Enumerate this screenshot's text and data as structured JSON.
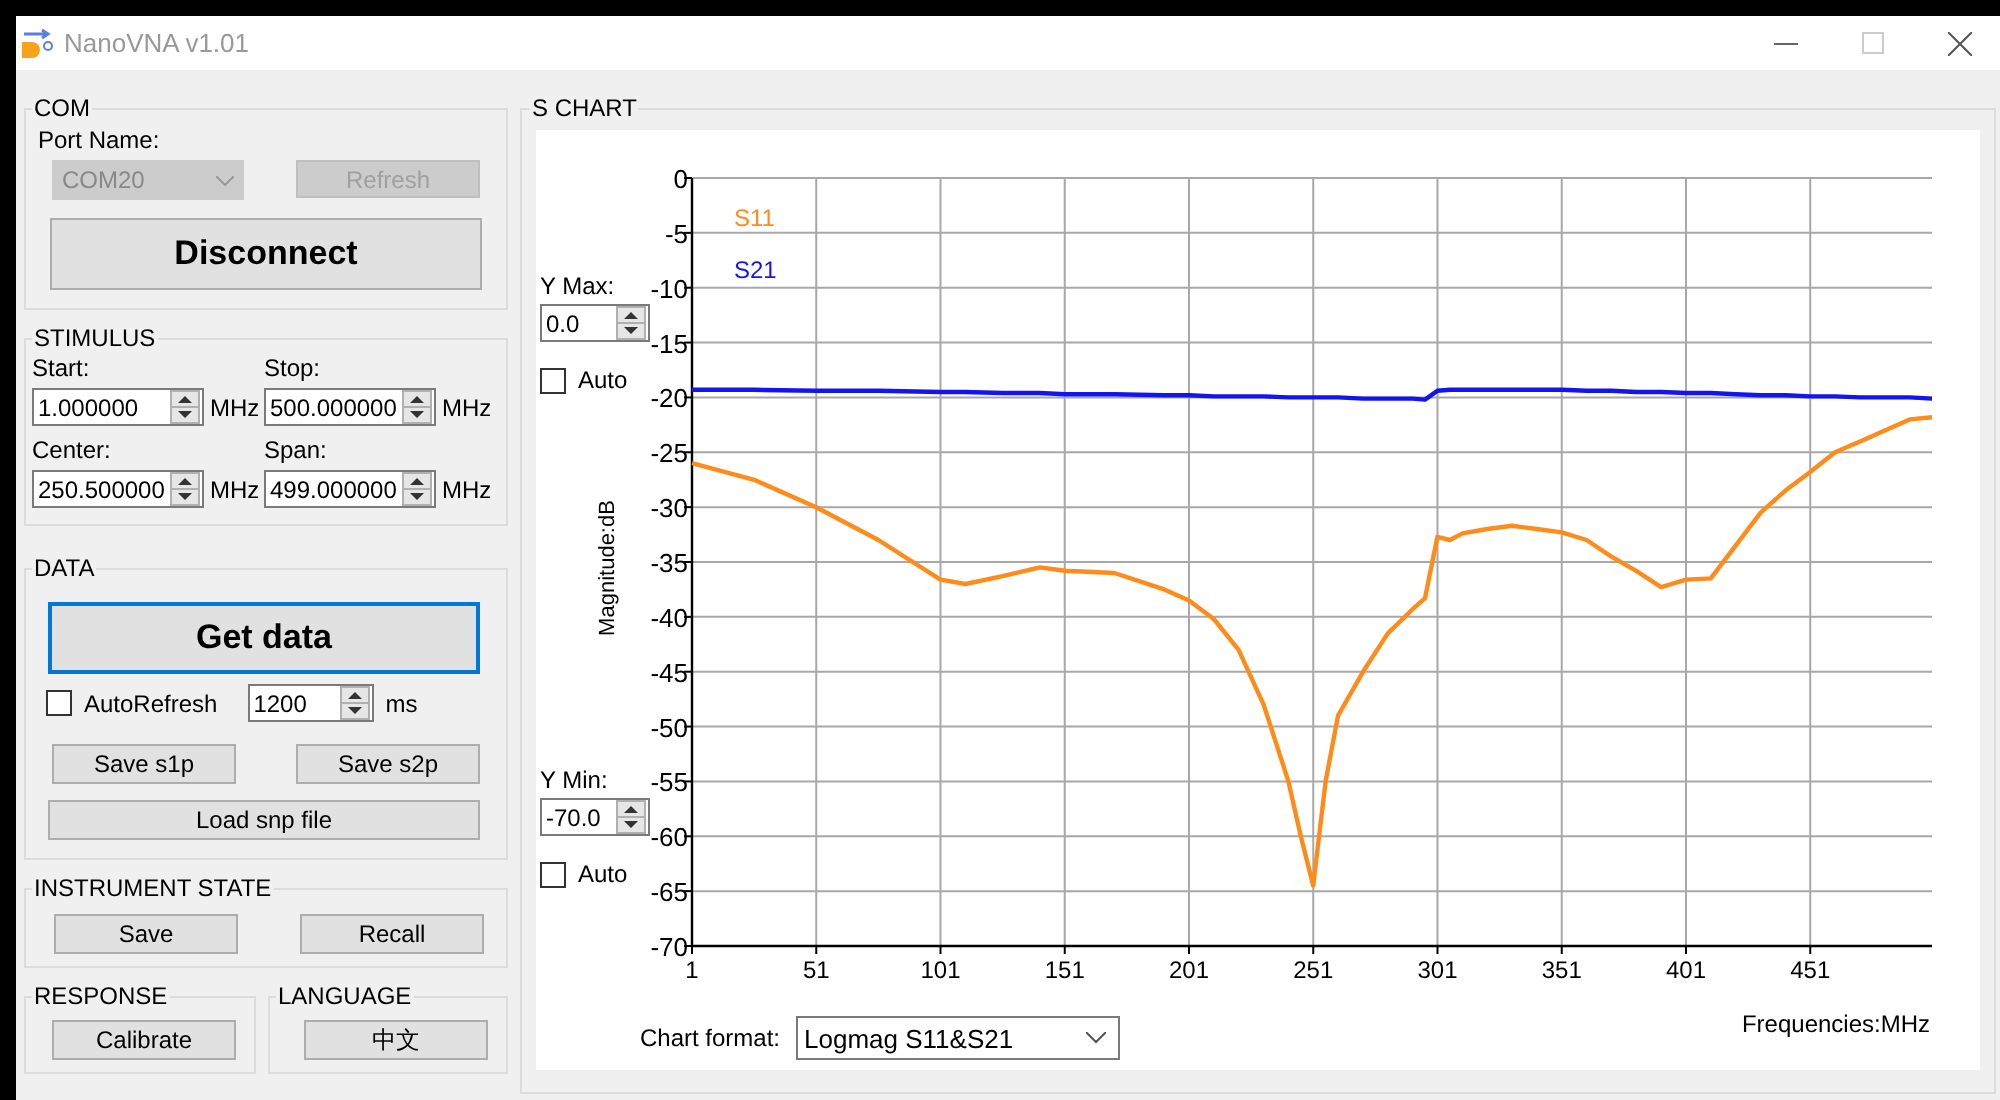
{
  "window": {
    "title": "NanoVNA v1.01"
  },
  "com": {
    "title": "COM",
    "port_label": "Port Name:",
    "port": {
      "value": "COM20",
      "disabled": true
    },
    "refresh": {
      "label": "Refresh",
      "disabled": true
    },
    "connect_button": {
      "label": "Disconnect",
      "disabled": false
    }
  },
  "stimulus": {
    "title": "STIMULUS",
    "fields": [
      {
        "label": "Start:",
        "value": "1.000000",
        "unit": "MHz"
      },
      {
        "label": "Stop:",
        "value": "500.000000",
        "unit": "MHz"
      },
      {
        "label": "Center:",
        "value": "250.500000",
        "unit": "MHz"
      },
      {
        "label": "Span:",
        "value": "499.000000",
        "unit": "MHz"
      }
    ]
  },
  "data": {
    "title": "DATA",
    "get_button": {
      "label": "Get data",
      "focused": true
    },
    "auto_refresh": {
      "label": "AutoRefresh",
      "checked": false
    },
    "interval": {
      "value": "1200",
      "unit": "ms"
    },
    "buttons": [
      "Save s1p",
      "Save s2p",
      "Load snp file"
    ]
  },
  "instrument_state": {
    "title": "INSTRUMENT STATE",
    "buttons": [
      "Save",
      "Recall"
    ]
  },
  "response": {
    "title": "RESPONSE",
    "buttons": [
      "Calibrate"
    ]
  },
  "language": {
    "title": "LANGUAGE",
    "buttons": [
      "中文"
    ]
  },
  "s_chart": {
    "title": "S CHART",
    "y_max": {
      "label": "Y Max:",
      "value": "0.0",
      "auto": {
        "label": "Auto",
        "checked": false
      }
    },
    "y_min": {
      "label": "Y Min:",
      "value": "-70.0",
      "auto": {
        "label": "Auto",
        "checked": false
      }
    },
    "chart_format": {
      "label": "Chart format:",
      "value": "Logmag S11&S21"
    },
    "chart_data": {
      "type": "line",
      "grid": true,
      "xlabel": "Frequencies:MHz",
      "ylabel": "Magnitude:dB",
      "xlim": [
        1,
        500
      ],
      "ylim": [
        -70,
        0
      ],
      "xticks": [
        1,
        51,
        101,
        151,
        201,
        251,
        301,
        351,
        401,
        451
      ],
      "yticks": [
        0,
        -5,
        -10,
        -15,
        -20,
        -25,
        -30,
        -35,
        -40,
        -45,
        -50,
        -55,
        -60,
        -65,
        -70
      ],
      "x": [
        1,
        26,
        51,
        76,
        101,
        111,
        126,
        141,
        151,
        171,
        191,
        201,
        211,
        221,
        231,
        241,
        246,
        251,
        256,
        261,
        271,
        281,
        291,
        296,
        301,
        306,
        311,
        321,
        331,
        341,
        351,
        361,
        371,
        381,
        391,
        401,
        411,
        421,
        431,
        441,
        451,
        461,
        471,
        481,
        491,
        500
      ],
      "series": [
        {
          "name": "S11",
          "color": "#ff8c1a",
          "values": [
            -26,
            -27.5,
            -30,
            -33,
            -36.6,
            -37,
            -36.3,
            -35.5,
            -35.8,
            -36,
            -37.5,
            -38.5,
            -40.2,
            -43,
            -48,
            -55,
            -60,
            -64.5,
            -55,
            -49,
            -45,
            -41.5,
            -39.3,
            -38.3,
            -32.7,
            -33,
            -32.4,
            -32,
            -31.7,
            -32,
            -32.3,
            -33,
            -34.5,
            -35.8,
            -37.3,
            -36.6,
            -36.5,
            -33.5,
            -30.5,
            -28.5,
            -26.8,
            -25,
            -24,
            -23,
            -22,
            -21.8
          ]
        },
        {
          "name": "S21",
          "color": "#1414f0",
          "values": [
            -19.3,
            -19.3,
            -19.4,
            -19.4,
            -19.5,
            -19.5,
            -19.6,
            -19.6,
            -19.7,
            -19.7,
            -19.8,
            -19.8,
            -19.9,
            -19.9,
            -19.9,
            -20,
            -20,
            -20,
            -20,
            -20,
            -20.1,
            -20.1,
            -20.1,
            -20.2,
            -19.4,
            -19.3,
            -19.3,
            -19.3,
            -19.3,
            -19.3,
            -19.3,
            -19.4,
            -19.4,
            -19.5,
            -19.5,
            -19.6,
            -19.6,
            -19.7,
            -19.8,
            -19.8,
            -19.9,
            -19.9,
            -20,
            -20,
            -20,
            -20.1
          ]
        }
      ]
    }
  }
}
